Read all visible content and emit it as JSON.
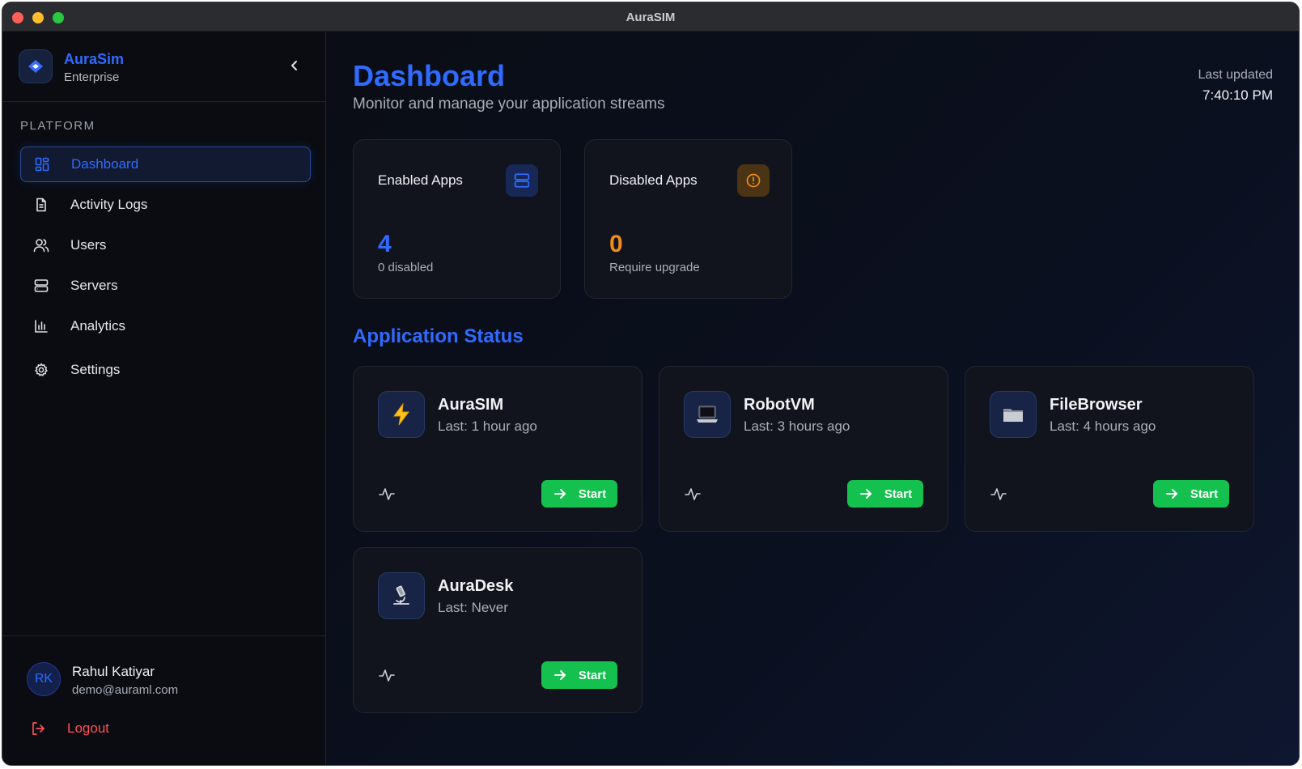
{
  "window": {
    "title": "AuraSIM"
  },
  "brand": {
    "name": "AuraSim",
    "subtitle": "Enterprise"
  },
  "sidebar": {
    "section_label": "PLATFORM",
    "items": [
      {
        "label": "Dashboard",
        "icon": "dashboard-grid-icon",
        "active": true
      },
      {
        "label": "Activity Logs",
        "icon": "document-icon",
        "active": false
      },
      {
        "label": "Users",
        "icon": "users-icon",
        "active": false
      },
      {
        "label": "Servers",
        "icon": "server-icon",
        "active": false
      },
      {
        "label": "Analytics",
        "icon": "bar-chart-icon",
        "active": false
      },
      {
        "label": "Settings",
        "icon": "gear-icon",
        "active": false
      }
    ]
  },
  "user": {
    "initials": "RK",
    "name": "Rahul Katiyar",
    "email": "demo@auraml.com",
    "logout_label": "Logout"
  },
  "header": {
    "title": "Dashboard",
    "subtitle": "Monitor and manage your application streams",
    "updated_label": "Last updated",
    "updated_time": "7:40:10 PM"
  },
  "stats": [
    {
      "title": "Enabled Apps",
      "value": "4",
      "sub": "0 disabled",
      "icon": "server-icon",
      "color": "#2f6bff"
    },
    {
      "title": "Disabled Apps",
      "value": "0",
      "sub": "Require upgrade",
      "icon": "alert-circle-icon",
      "color": "#f08a1c"
    }
  ],
  "apps_section_title": "Application Status",
  "apps": [
    {
      "name": "AuraSIM",
      "last": "Last: 1 hour ago",
      "icon": "lightning-icon",
      "button": "Start"
    },
    {
      "name": "RobotVM",
      "last": "Last: 3 hours ago",
      "icon": "laptop-icon",
      "button": "Start"
    },
    {
      "name": "FileBrowser",
      "last": "Last: 4 hours ago",
      "icon": "folder-icon",
      "button": "Start"
    },
    {
      "name": "AuraDesk",
      "last": "Last: Never",
      "icon": "microscope-icon",
      "button": "Start"
    }
  ],
  "colors": {
    "accent": "#2f6bff",
    "success": "#14c14f",
    "warning": "#f08a1c",
    "danger": "#ff4d57"
  }
}
